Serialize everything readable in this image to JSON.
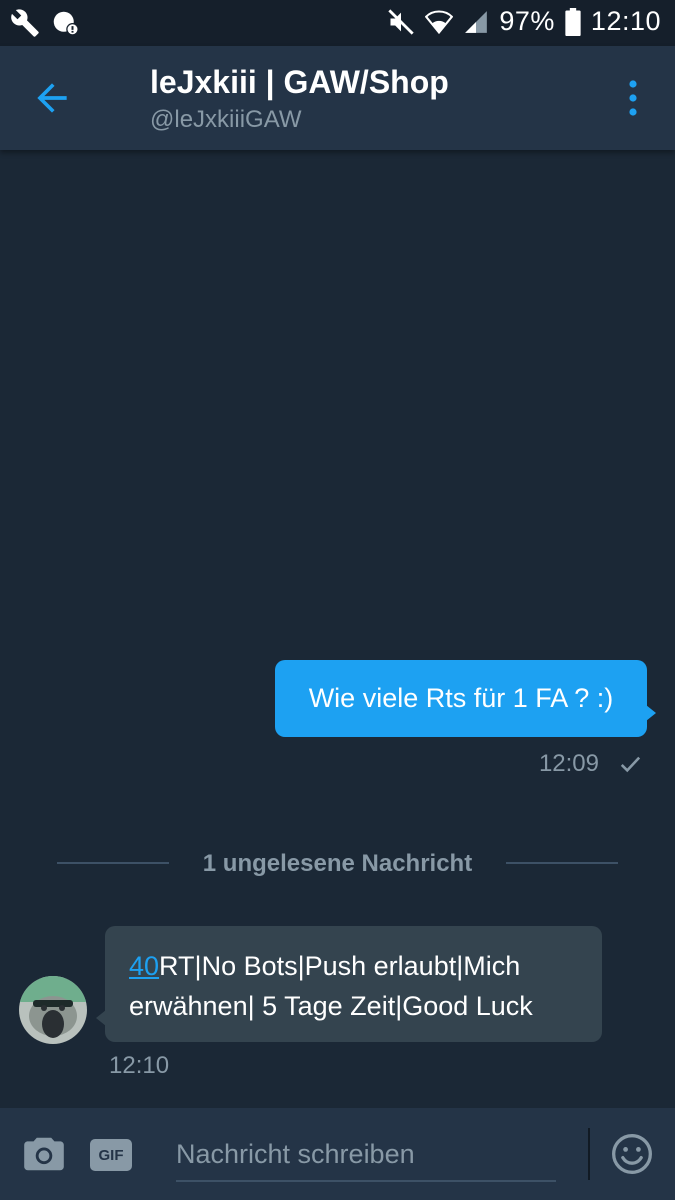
{
  "status_bar": {
    "battery": "97%",
    "time": "12:10",
    "icons": [
      "wrench-icon",
      "data-saver-icon",
      "mute-icon",
      "wifi-icon",
      "signal-icon",
      "battery-icon"
    ]
  },
  "header": {
    "title": "leJxkiii | GAW/Shop",
    "handle": "@leJxkiiiGAW",
    "back_icon": "arrow-left-icon",
    "menu_icon": "more-vertical-icon"
  },
  "messages": {
    "outgoing": {
      "text": "Wie viele Rts für 1 FA ? :)",
      "time": "12:09",
      "status_icon": "checkmark-icon"
    },
    "divider": "1 ungelesene Nachricht",
    "incoming": {
      "link": "40",
      "text_rest_1": "RT|No Bots|Push erlaubt|Mich",
      "text_line_2": "erwähnen| 5 Tage Zeit|Good Luck",
      "time": "12:10"
    }
  },
  "composer": {
    "gif_label": "GIF",
    "placeholder": "Nachricht schreiben"
  },
  "colors": {
    "background": "#1b2836",
    "header": "#243447",
    "accent": "#1da1f2",
    "incoming_bubble": "#34444f",
    "muted_text": "#8899a6"
  }
}
